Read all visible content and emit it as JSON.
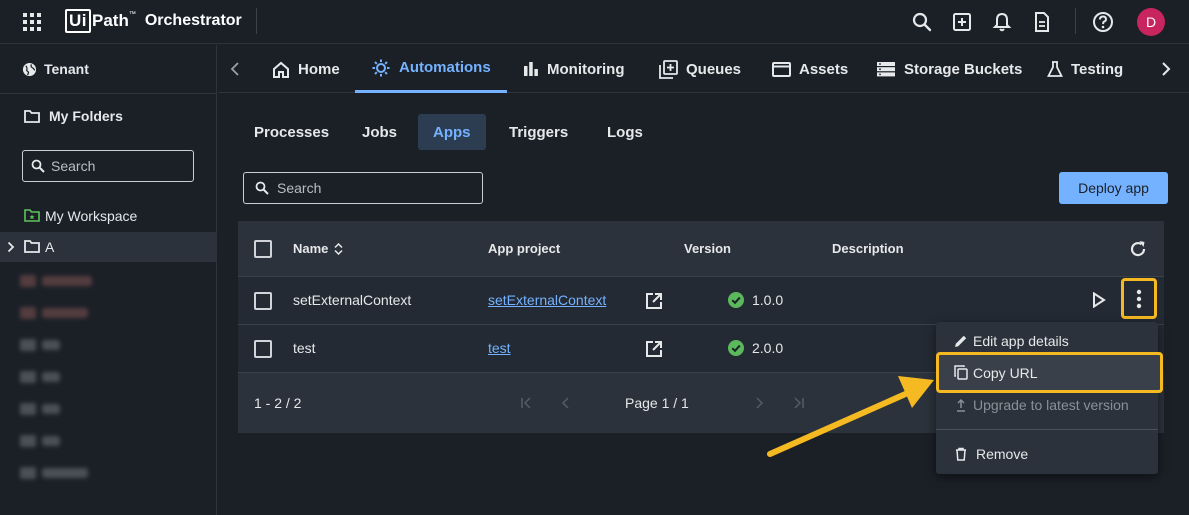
{
  "topbar": {
    "logo_ui": "Ui",
    "logo_path": "Path",
    "logo_tm": "™",
    "product": "Orchestrator",
    "avatar_initial": "D",
    "icons": [
      "search-icon",
      "add-icon",
      "bell-icon",
      "document-icon",
      "help-icon"
    ]
  },
  "sidebar": {
    "tenant": "Tenant",
    "my_folders": "My Folders",
    "search_placeholder": "Search",
    "items": [
      {
        "label": "My Workspace"
      },
      {
        "label": "A"
      }
    ]
  },
  "nav": {
    "tabs": [
      {
        "label": "Home"
      },
      {
        "label": "Automations"
      },
      {
        "label": "Monitoring"
      },
      {
        "label": "Queues"
      },
      {
        "label": "Assets"
      },
      {
        "label": "Storage Buckets"
      },
      {
        "label": "Testing"
      }
    ]
  },
  "subtabs": [
    {
      "label": "Processes"
    },
    {
      "label": "Jobs"
    },
    {
      "label": "Apps"
    },
    {
      "label": "Triggers"
    },
    {
      "label": "Logs"
    }
  ],
  "search": {
    "placeholder": "Search"
  },
  "deploy_button": "Deploy app",
  "table": {
    "headers": {
      "name": "Name",
      "app_project": "App project",
      "version": "Version",
      "description": "Description"
    },
    "rows": [
      {
        "name": "setExternalContext",
        "app_project": "setExternalContext",
        "version": "1.0.0",
        "description": ""
      },
      {
        "name": "test",
        "app_project": "test",
        "version": "2.0.0",
        "description": ""
      }
    ],
    "footer": {
      "range": "1 - 2 / 2",
      "page": "Page 1 / 1"
    }
  },
  "context_menu": {
    "items": [
      {
        "label": "Edit app details"
      },
      {
        "label": "Copy URL"
      },
      {
        "label": "Upgrade to latest version"
      },
      {
        "label": "Remove"
      }
    ]
  },
  "colors": {
    "accent": "#74b2ff",
    "highlight": "#f5b921",
    "success": "#5cb85c",
    "avatar": "#c8245e"
  }
}
